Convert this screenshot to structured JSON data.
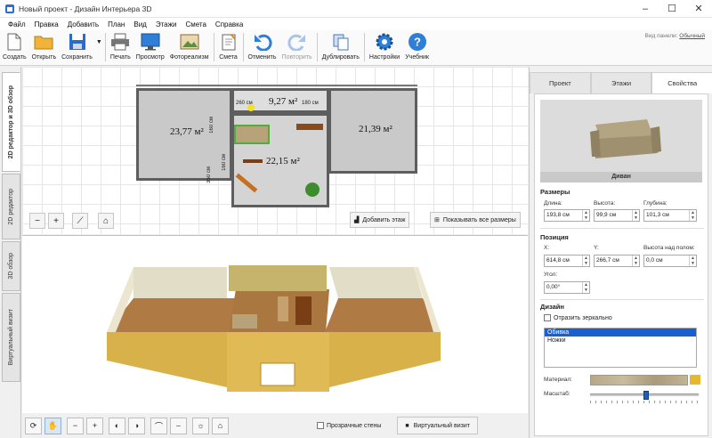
{
  "window": {
    "title": "Новый проект - Дизайн Интерьера 3D"
  },
  "menu": [
    "Файл",
    "Правка",
    "Добавить",
    "План",
    "Вид",
    "Этажи",
    "Смета",
    "Справка"
  ],
  "toolbar": {
    "create": "Создать",
    "open": "Открыть",
    "save": "Сохранить",
    "print": "Печать",
    "preview": "Просмотр",
    "photo": "Фотореализм",
    "estimate": "Смета",
    "undo": "Отменить",
    "redo": "Повторить",
    "duplicate": "Дублировать",
    "settings": "Настройки",
    "tutorial": "Учебник"
  },
  "panel_view": {
    "label": "Вид панели:",
    "value": "Обычный"
  },
  "side_tabs": [
    "2D редактор и 3D обзор",
    "2D редактор",
    "3D обзор",
    "Виртуальный визит"
  ],
  "plan": {
    "rooms": [
      "23,77 м²",
      "9,27 м²",
      "21,39 м²",
      "22,15 м²"
    ],
    "dims": [
      "260 см",
      "180 см",
      "350 см",
      "160 см",
      "160 см"
    ],
    "add_floor": "Добавить этаж",
    "show_sizes": "Показывать все размеры"
  },
  "bottom": {
    "transparent_walls": "Прозрачные стены",
    "virtual_visit": "Виртуальный визит"
  },
  "right_tabs": {
    "project": "Проект",
    "floors": "Этажи",
    "properties": "Свойства"
  },
  "props": {
    "item_name": "Диван",
    "sizes_title": "Размеры",
    "length_label": "Длина:",
    "length": "193,8 см",
    "height_label": "Высота:",
    "height": "99,9 см",
    "depth_label": "Глубина:",
    "depth": "101,3 см",
    "position_title": "Позиция",
    "x_label": "X:",
    "x": "614,8 см",
    "y_label": "Y:",
    "y": "266,7 см",
    "floor_h_label": "Высота над полом:",
    "floor_h": "0,0 см",
    "angle_label": "Угол:",
    "angle": "0,00°",
    "design_title": "Дизайн",
    "mirror": "Отразить зеркально",
    "parts": [
      "Обивка",
      "Ножки"
    ],
    "material_label": "Материал:",
    "scale_label": "Масштаб:"
  },
  "colors": {
    "accent": "#1a5fd0",
    "floor": "#b07a45",
    "wall": "#d9b14a"
  }
}
